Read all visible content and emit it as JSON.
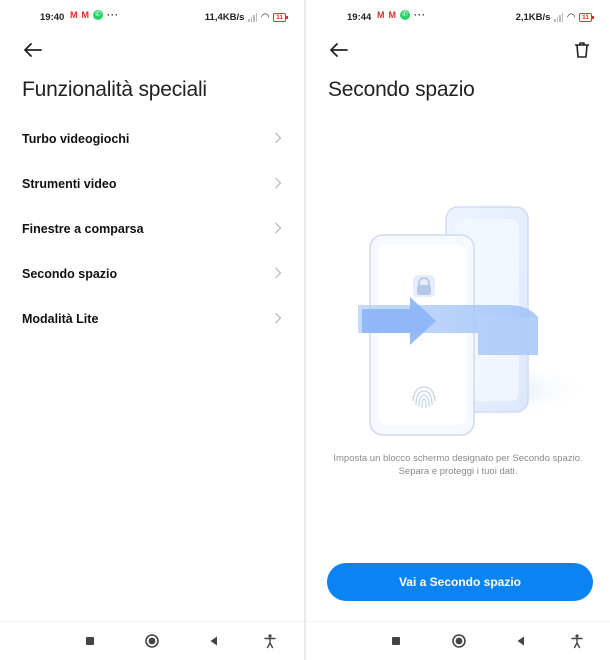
{
  "colors": {
    "accent": "#0b84f3",
    "gmail": "#d93025",
    "whatsapp": "#25d366",
    "battery_low": "#d33333"
  },
  "left": {
    "status": {
      "time": "19:40",
      "speed": "11,4KB/s",
      "battery": "11"
    },
    "title": "Funzionalità speciali",
    "menu": [
      {
        "label": "Turbo videogiochi"
      },
      {
        "label": "Strumenti video"
      },
      {
        "label": "Finestre a comparsa"
      },
      {
        "label": "Secondo spazio"
      },
      {
        "label": "Modalità Lite"
      }
    ]
  },
  "right": {
    "status": {
      "time": "19:44",
      "speed": "2,1KB/s",
      "battery": "11"
    },
    "title": "Secondo spazio",
    "description_line1": "Imposta un blocco schermo designato per Secondo spazio.",
    "description_line2": "Separa e proteggi i tuoi dati.",
    "cta_label": "Vai a Secondo spazio"
  },
  "icons": {
    "status": [
      "gmail-icon",
      "whatsapp-icon",
      "more-icon",
      "signal-icon",
      "wifi-icon",
      "battery-icon"
    ],
    "header": [
      "back-arrow-icon",
      "trash-icon"
    ],
    "nav": [
      "recents-square-icon",
      "home-circle-icon",
      "back-triangle-icon",
      "accessibility-icon"
    ],
    "illustration": [
      "lock-icon",
      "fingerprint-icon",
      "arrow-right-icon"
    ]
  }
}
